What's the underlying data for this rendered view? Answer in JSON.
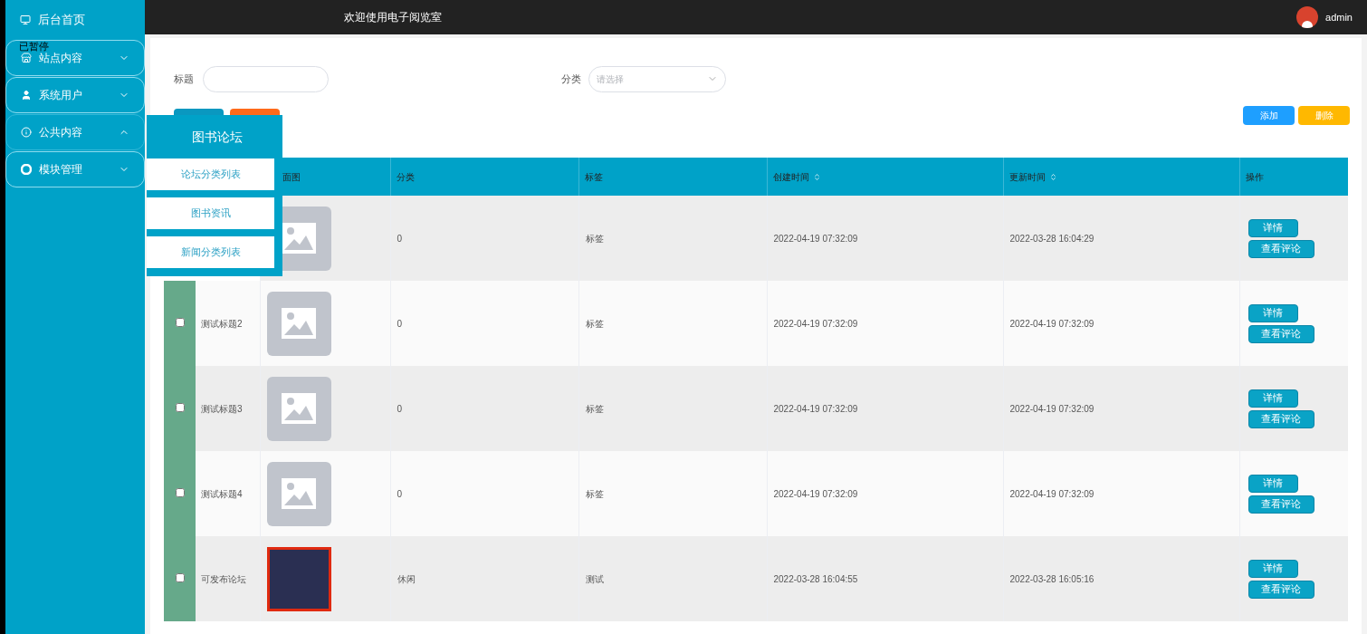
{
  "header": {
    "title": "欢迎使用电子阅览室",
    "user": "admin"
  },
  "sidebar": {
    "home": "后台首页",
    "paused_badge": "已暂停",
    "items": [
      {
        "label": "站点内容",
        "expanded": false
      },
      {
        "label": "系统用户",
        "expanded": false
      },
      {
        "label": "公共内容",
        "expanded": true
      },
      {
        "label": "模块管理",
        "expanded": false
      }
    ]
  },
  "flyout": {
    "title": "图书论坛",
    "items": [
      "论坛分类列表",
      "图书资讯",
      "新闻分类列表"
    ]
  },
  "filters": {
    "title_label": "标题",
    "category_label": "分类",
    "category_placeholder": "请选择"
  },
  "filter_buttons": [
    {
      "kind": "primary"
    },
    {
      "kind": "warning"
    }
  ],
  "actions": [
    {
      "label": "添加",
      "kind": "primary"
    },
    {
      "label": "删除",
      "kind": "warning"
    }
  ],
  "table": {
    "columns": [
      {
        "label": "面图",
        "sortable": false
      },
      {
        "label": "分类",
        "sortable": false
      },
      {
        "label": "标签",
        "sortable": false
      },
      {
        "label": "创建时间",
        "sortable": true
      },
      {
        "label": "更新时间",
        "sortable": true
      },
      {
        "label": "操作",
        "sortable": false
      }
    ],
    "rows": [
      {
        "cover": {
          "kind": "placeholder"
        },
        "category": "0",
        "tag": "标签",
        "created": "2022-04-19 07:32:09",
        "updated": "2022-03-28 16:04:29",
        "buttons": [
          "详情",
          "查看评论"
        ]
      },
      {
        "checked": false,
        "title": "测试标题2",
        "cover": {
          "kind": "placeholder"
        },
        "category": "0",
        "tag": "标签",
        "created": "2022-04-19 07:32:09",
        "updated": "2022-04-19 07:32:09",
        "buttons": [
          "详情",
          "查看评论"
        ]
      },
      {
        "checked": false,
        "title": "测试标题3",
        "cover": {
          "kind": "placeholder"
        },
        "category": "0",
        "tag": "标签",
        "created": "2022-04-19 07:32:09",
        "updated": "2022-04-19 07:32:09",
        "buttons": [
          "详情",
          "查看评论"
        ]
      },
      {
        "checked": false,
        "title": "测试标题4",
        "cover": {
          "kind": "placeholder"
        },
        "category": "0",
        "tag": "标签",
        "created": "2022-04-19 07:32:09",
        "updated": "2022-04-19 07:32:09",
        "buttons": [
          "详情",
          "查看评论"
        ]
      },
      {
        "checked": false,
        "title": "可发布论坛",
        "cover": {
          "kind": "photo"
        },
        "category": "休闲",
        "tag": "测试",
        "created": "2022-03-28 16:04:55",
        "updated": "2022-03-28 16:05:16",
        "buttons": [
          "详情",
          "查看评论"
        ]
      }
    ]
  }
}
